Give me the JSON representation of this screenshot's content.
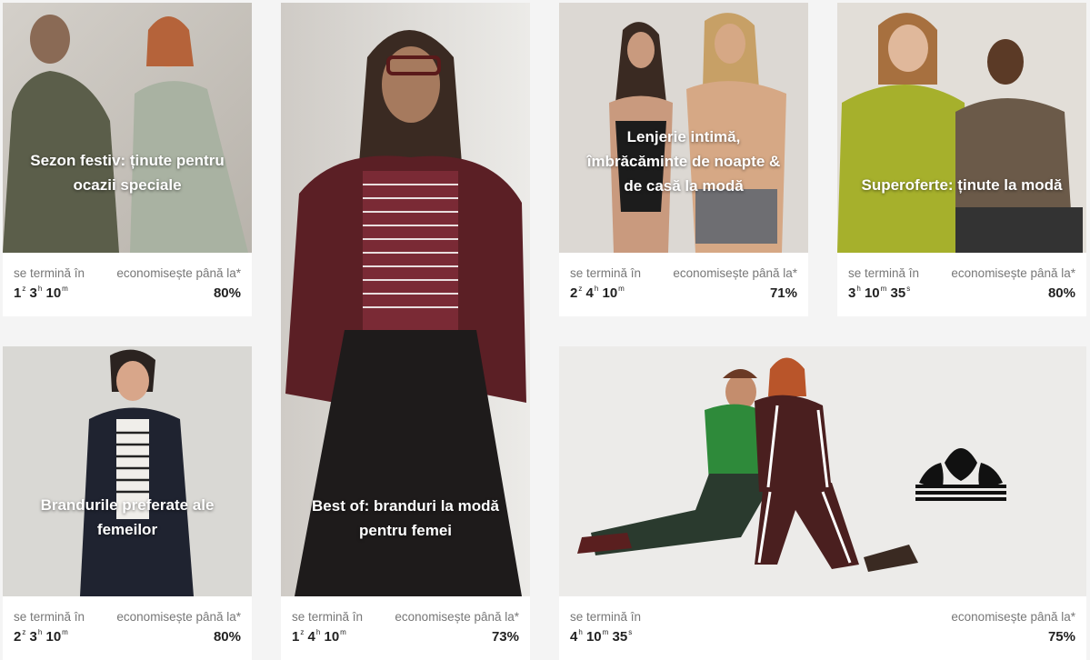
{
  "labels": {
    "ends_in": "se termină în",
    "save_up_to": "economisește până la*"
  },
  "cards": [
    {
      "title_line1": "Sezon festiv: ținute pentru",
      "title_line2": "ocazii speciale",
      "timer": [
        {
          "v": "1",
          "u": "z"
        },
        {
          "v": "3",
          "u": "h"
        },
        {
          "v": "10",
          "u": "m"
        }
      ],
      "discount": "80%"
    },
    {
      "title_line1": "Best of: branduri la modă",
      "title_line2": "pentru femei",
      "timer": [
        {
          "v": "1",
          "u": "z"
        },
        {
          "v": "4",
          "u": "h"
        },
        {
          "v": "10",
          "u": "m"
        }
      ],
      "discount": "73%"
    },
    {
      "title_line1": "Lenjerie intimă,",
      "title_line2": "îmbrăcăminte de noapte &",
      "title_line3": "de casă la modă",
      "timer": [
        {
          "v": "2",
          "u": "z"
        },
        {
          "v": "4",
          "u": "h"
        },
        {
          "v": "10",
          "u": "m"
        }
      ],
      "discount": "71%"
    },
    {
      "title_line1": "Superoferte: ținute la modă",
      "timer": [
        {
          "v": "3",
          "u": "h"
        },
        {
          "v": "10",
          "u": "m"
        },
        {
          "v": "35",
          "u": "s"
        }
      ],
      "discount": "80%"
    },
    {
      "title_line1": "Brandurile preferate ale",
      "title_line2": "femeilor",
      "timer": [
        {
          "v": "2",
          "u": "z"
        },
        {
          "v": "3",
          "u": "h"
        },
        {
          "v": "10",
          "u": "m"
        }
      ],
      "discount": "80%"
    },
    {
      "timer": [
        {
          "v": "4",
          "u": "h"
        },
        {
          "v": "10",
          "u": "m"
        },
        {
          "v": "35",
          "u": "s"
        }
      ],
      "discount": "75%",
      "logo": "adidas-trefoil-logo"
    }
  ]
}
